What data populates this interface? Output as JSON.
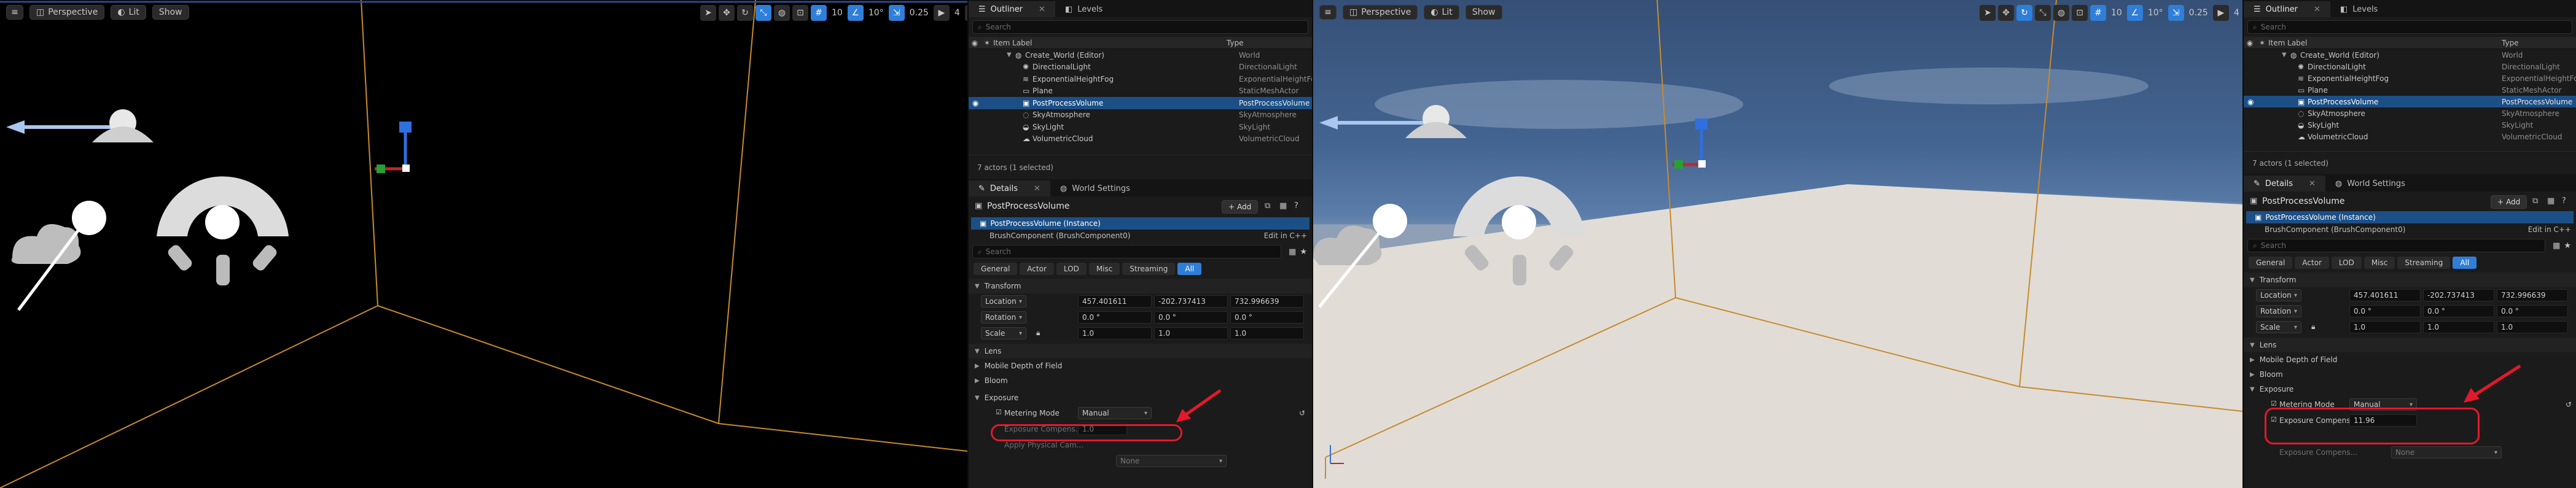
{
  "viewport_bar": {
    "menu_icon": "hamburger-icon",
    "perspective": "Perspective",
    "lit": "Lit",
    "show": "Show",
    "grid_snap": "10",
    "rot_snap": "10°",
    "scale_snap": "0.25",
    "cam_speed": "4"
  },
  "outliner": {
    "tab_outliner": "Outliner",
    "tab_levels": "Levels",
    "search_placeholder": "Search",
    "col_label": "Item Label",
    "col_type": "Type",
    "rows": [
      {
        "label": "Create_World (Editor)",
        "type": "World"
      },
      {
        "label": "DirectionalLight",
        "type": "DirectionalLight"
      },
      {
        "label": "ExponentialHeightFog",
        "type": "ExponentialHeightFog"
      },
      {
        "label": "Plane",
        "type": "StaticMeshActor"
      },
      {
        "label": "PostProcessVolume",
        "type": "PostProcessVolume"
      },
      {
        "label": "SkyAtmosphere",
        "type": "SkyAtmosphere"
      },
      {
        "label": "SkyLight",
        "type": "SkyLight"
      },
      {
        "label": "VolumetricCloud",
        "type": "VolumetricCloud"
      }
    ],
    "status": "7 actors (1 selected)"
  },
  "details": {
    "tab_details": "Details",
    "tab_world_settings": "World Settings",
    "actor_name": "PostProcessVolume",
    "add_label": "Add",
    "instance": "PostProcessVolume (Instance)",
    "component": "BrushComponent (BrushComponent0)",
    "edit_cpp": "Edit in C++",
    "search_placeholder": "Search",
    "categories": [
      "General",
      "Actor",
      "LOD",
      "Misc",
      "Streaming",
      "All"
    ],
    "transform": "Transform",
    "location_label": "Location",
    "rotation_label": "Rotation",
    "scale_label": "Scale",
    "loc": [
      "457.401611",
      "-202.737413",
      "732.996639"
    ],
    "rot": [
      "0.0 °",
      "0.0 °",
      "0.0 °"
    ],
    "scale": [
      "1.0",
      "1.0",
      "1.0"
    ],
    "lens": "Lens",
    "mobile_dof": "Mobile Depth of Field",
    "bloom": "Bloom",
    "exposure": "Exposure",
    "metering_mode_label": "Metering Mode",
    "metering_mode_value": "Manual",
    "exposure_comp_label": "Exposure Compens...",
    "exposure_comp_value_left": "1.0",
    "exposure_comp_value_right": "11.96",
    "apply_physical": "Apply Physical Cam...",
    "exposure_comp_label2": "Exposure Compens...",
    "none_value": "None"
  },
  "colors": {
    "accent": "#2f7ed8",
    "selection": "#1c4f86",
    "annotation_red": "#e3192b",
    "orange_line": "#c88a2e"
  }
}
